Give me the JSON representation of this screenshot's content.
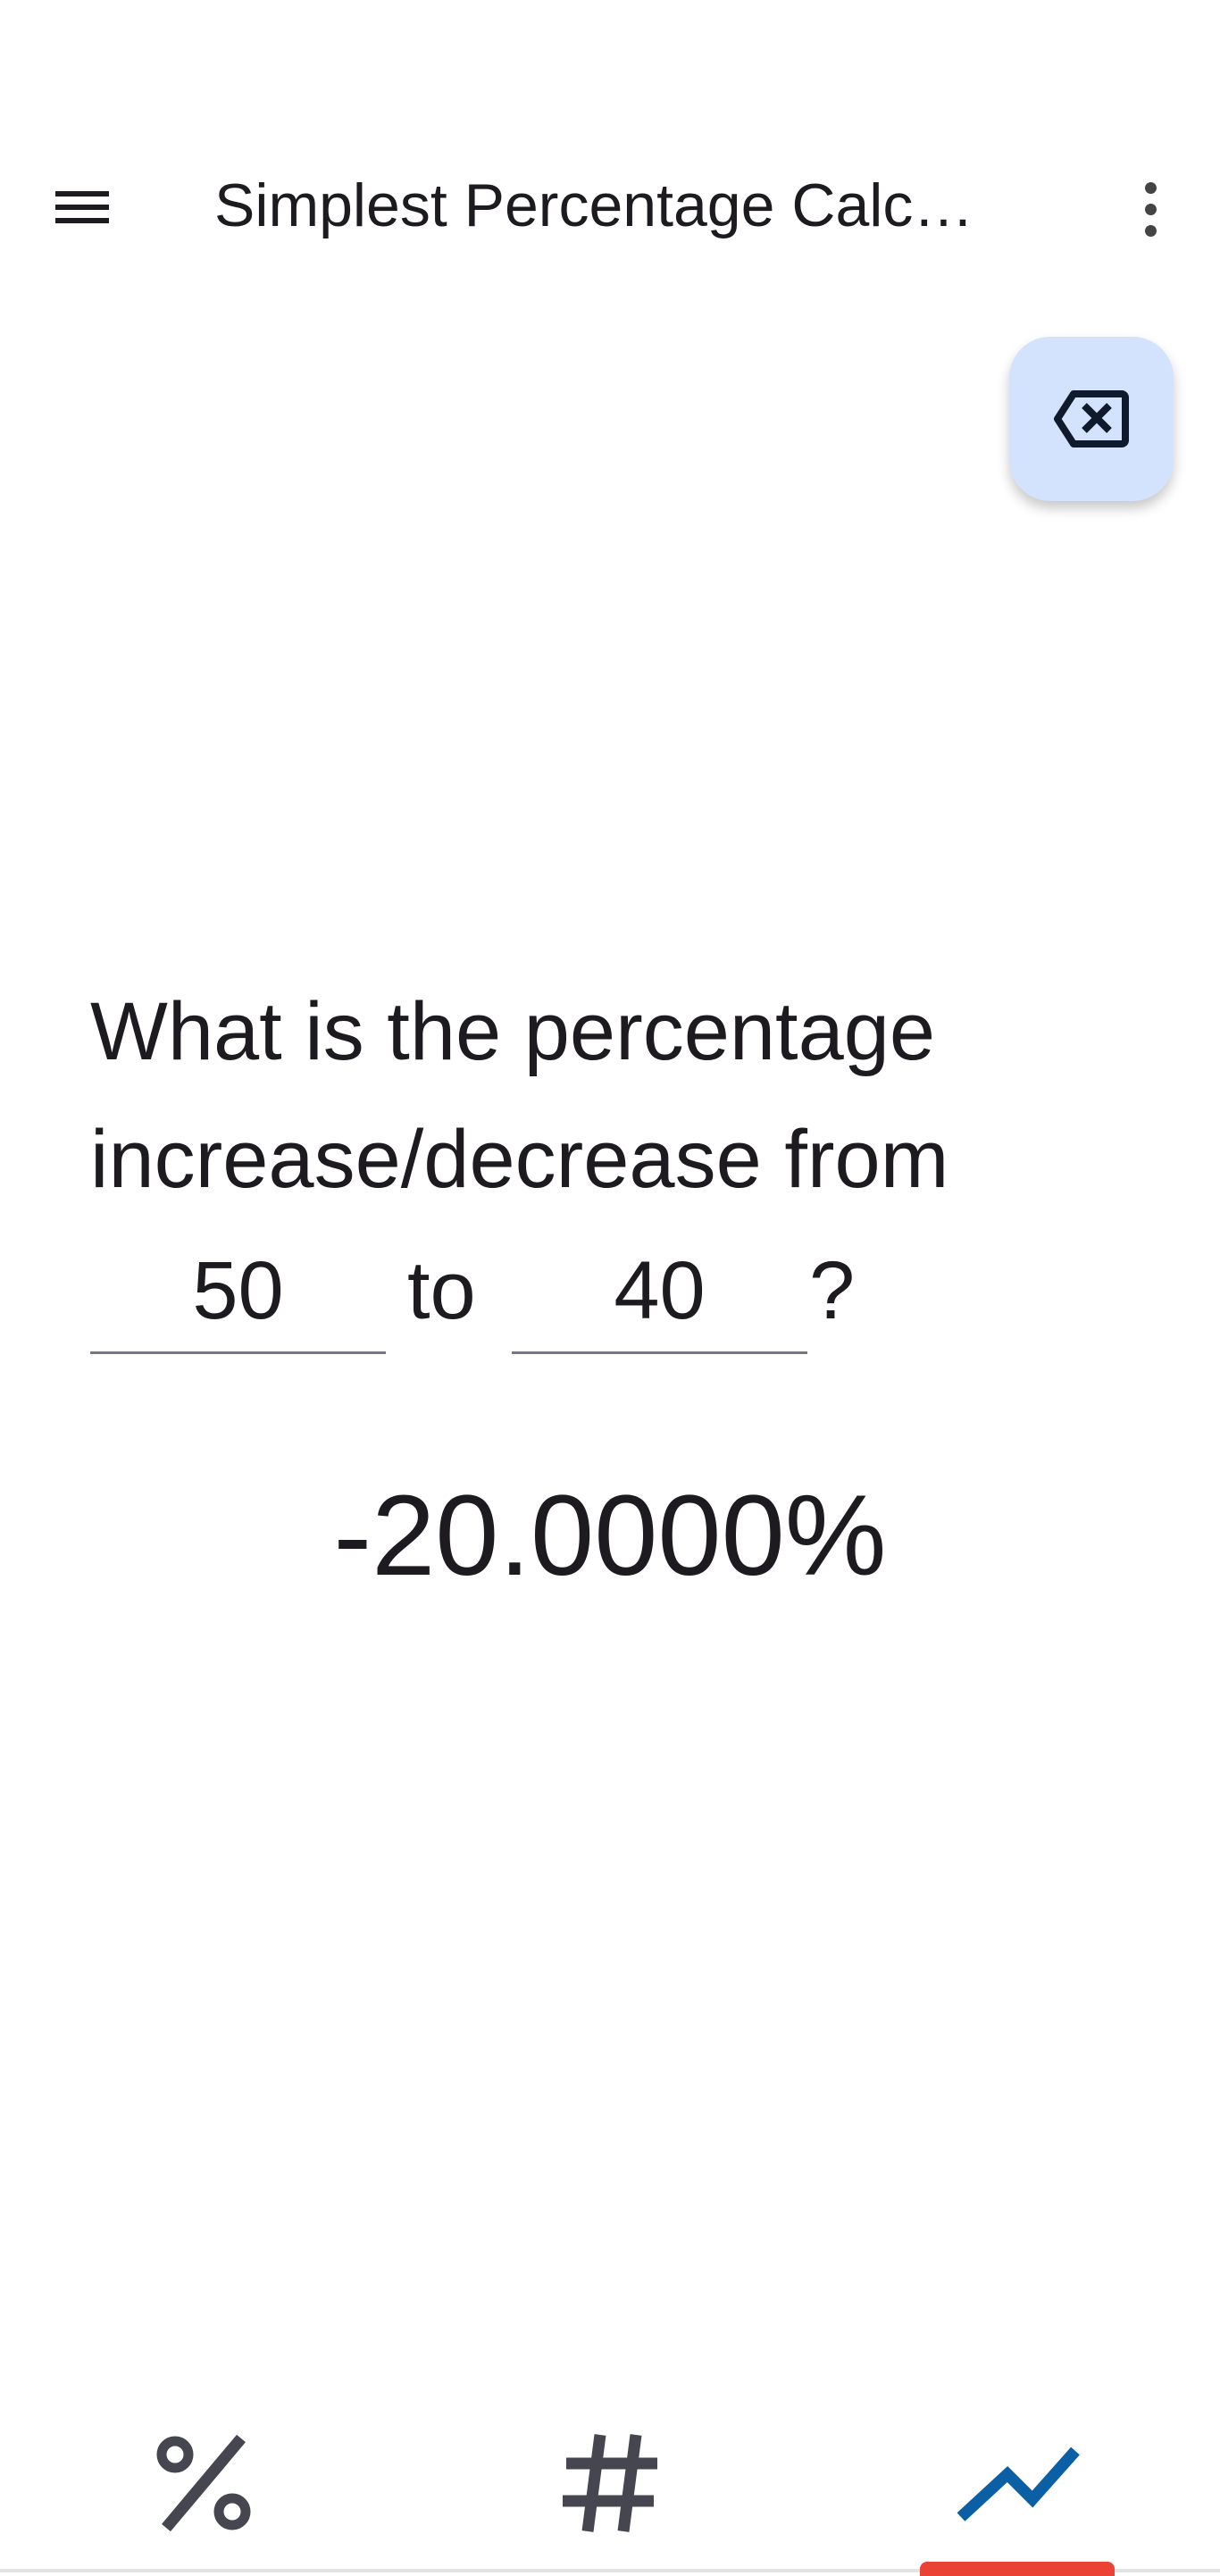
{
  "app_bar": {
    "title": "Simplest Percentage Calc…",
    "menu_icon": "hamburger-menu-icon",
    "more_icon": "more-vert-icon"
  },
  "fab": {
    "icon": "backspace-icon",
    "color": "#d3e3fd"
  },
  "question": {
    "line1": "What is the percentage",
    "line2": "increase/decrease from",
    "from_value": "50",
    "connector": "to",
    "to_value": "40",
    "suffix": "?"
  },
  "result": "-20.0000%",
  "bottom_nav": {
    "items": [
      {
        "icon": "percent-icon",
        "selected": false
      },
      {
        "icon": "hash-icon",
        "selected": false
      },
      {
        "icon": "trending-up-icon",
        "selected": true
      }
    ],
    "selected_color": "#0b5fa5",
    "indicator_color": "#ea4335"
  }
}
